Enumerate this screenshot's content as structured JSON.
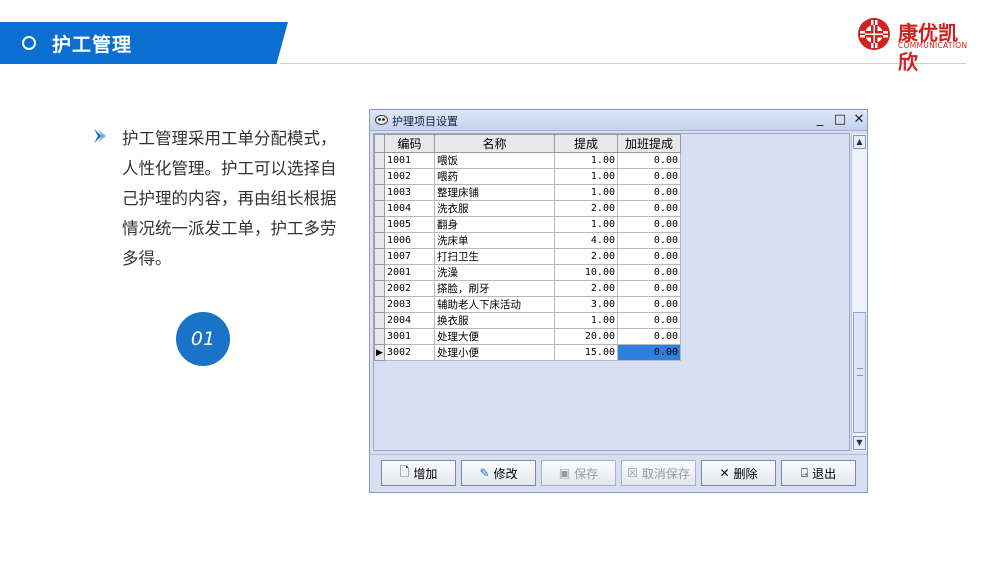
{
  "header": {
    "title": "护工管理"
  },
  "logo": {
    "name_cn": "康优凯欣",
    "name_en": "COMMUNICATION"
  },
  "description": "护工管理采用工单分配模式，人性化管理。护工可以选择自己护理的内容，再由组长根据情况统一派发工单，护工多劳多得。",
  "badge": "01",
  "window": {
    "title": "护理项目设置",
    "controls": {
      "minimize": "_",
      "maximize": "□",
      "close": "✕"
    },
    "columns": [
      "编码",
      "名称",
      "提成",
      "加班提成"
    ],
    "rows": [
      {
        "code": "1001",
        "name": "喂饭",
        "commission": "1.00",
        "overtime": "0.00"
      },
      {
        "code": "1002",
        "name": "喂药",
        "commission": "1.00",
        "overtime": "0.00"
      },
      {
        "code": "1003",
        "name": "整理床铺",
        "commission": "1.00",
        "overtime": "0.00"
      },
      {
        "code": "1004",
        "name": "洗衣服",
        "commission": "2.00",
        "overtime": "0.00"
      },
      {
        "code": "1005",
        "name": "翻身",
        "commission": "1.00",
        "overtime": "0.00"
      },
      {
        "code": "1006",
        "name": "洗床单",
        "commission": "4.00",
        "overtime": "0.00"
      },
      {
        "code": "1007",
        "name": "打扫卫生",
        "commission": "2.00",
        "overtime": "0.00"
      },
      {
        "code": "2001",
        "name": "洗澡",
        "commission": "10.00",
        "overtime": "0.00"
      },
      {
        "code": "2002",
        "name": "搽脸，刷牙",
        "commission": "2.00",
        "overtime": "0.00"
      },
      {
        "code": "2003",
        "name": "辅助老人下床活动",
        "commission": "3.00",
        "overtime": "0.00"
      },
      {
        "code": "2004",
        "name": "换衣服",
        "commission": "1.00",
        "overtime": "0.00"
      },
      {
        "code": "3001",
        "name": "处理大便",
        "commission": "20.00",
        "overtime": "0.00"
      },
      {
        "code": "3002",
        "name": "处理小便",
        "commission": "15.00",
        "overtime": "0.00"
      }
    ],
    "current_row_marker": "▶",
    "buttons": {
      "add": "增加",
      "edit": "修改",
      "save": "保存",
      "cancel_save": "取消保存",
      "delete": "删除",
      "exit": "退出"
    },
    "scroll": {
      "up": "▲",
      "down": "▼"
    }
  },
  "colors": {
    "brand_blue": "#0b6fd1",
    "logo_red": "#d32020",
    "selection": "#2f7fe0"
  }
}
